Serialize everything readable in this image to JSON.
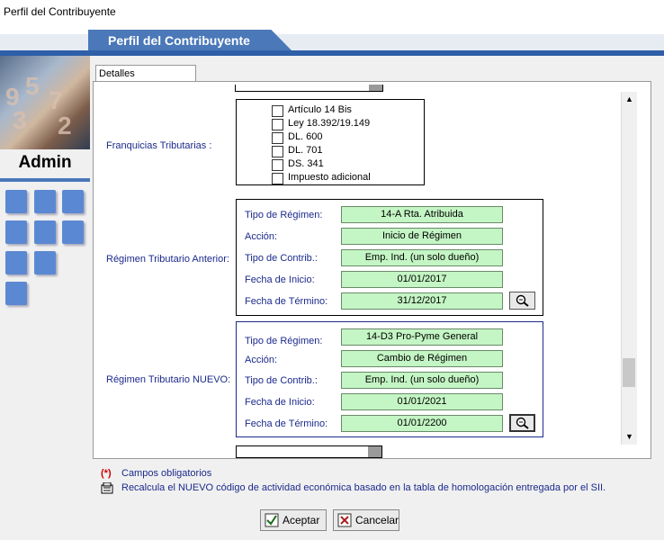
{
  "window": {
    "title": "Perfil del Contribuyente"
  },
  "header": {
    "tab_title": "Perfil del Contribuyente"
  },
  "sidebar": {
    "label": "Admin",
    "tiles": 9
  },
  "panel": {
    "tab": "Detalles Contribuyente"
  },
  "franquicias": {
    "label": "Franquicias Tributarias :",
    "items": [
      "Artículo 14 Bis",
      "Ley 18.392/19.149",
      "DL. 600",
      "DL. 701",
      "DS. 341",
      "Impuesto adicional"
    ]
  },
  "regimen_anterior": {
    "label": "Régimen Tributario Anterior:",
    "tipo_label": "Tipo de Régimen:",
    "tipo": "14-A Rta. Atribuida",
    "accion_label": "Acción:",
    "accion": "Inicio de Régimen",
    "contrib_label": "Tipo de Contrib.:",
    "contrib": "Emp. Ind. (un solo dueño)",
    "inicio_label": "Fecha de Inicio:",
    "inicio": "01/01/2017",
    "termino_label": "Fecha de Término:",
    "termino": "31/12/2017"
  },
  "regimen_nuevo": {
    "label": "Régimen Tributario NUEVO:",
    "tipo_label": "Tipo de Régimen:",
    "tipo": "14-D3 Pro-Pyme General",
    "accion_label": "Acción:",
    "accion": "Cambio de Régimen",
    "contrib_label": "Tipo de Contrib.:",
    "contrib": "Emp. Ind. (un solo dueño)",
    "inicio_label": "Fecha de Inicio:",
    "inicio": "01/01/2021",
    "termino_label": "Fecha de Término:",
    "termino": "01/01/2200"
  },
  "footer": {
    "required_mark": "(*)",
    "required_text": "Campos obligatorios",
    "recalc_text": "Recalcula el NUEVO código de actividad económica basado en la tabla de homologación entregada por el SII."
  },
  "buttons": {
    "accept": "Aceptar",
    "cancel": "Cancelar"
  }
}
